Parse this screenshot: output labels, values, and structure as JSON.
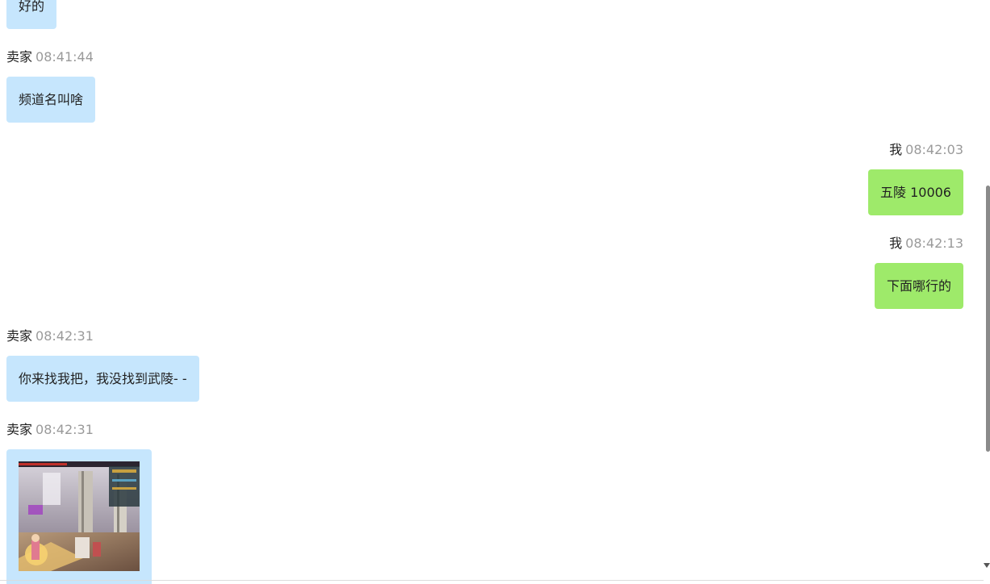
{
  "messages": [
    {
      "text": "好的"
    },
    {
      "sender": "卖家",
      "time": "08:41:44",
      "text": "频道名叫啥"
    },
    {
      "sender": "我",
      "time": "08:42:03",
      "text": "五陵 10006"
    },
    {
      "sender": "我",
      "time": "08:42:13",
      "text": "下面哪行的"
    },
    {
      "sender": "卖家",
      "time": "08:42:31",
      "text": "你来找我把，我没找到武陵- -"
    },
    {
      "sender": "卖家",
      "time": "08:42:31",
      "image": "game-screenshot"
    }
  ],
  "colors": {
    "seller_bubble": "#c6e6fd",
    "my_bubble": "#9eea6a",
    "timestamp": "#9a9a9a"
  }
}
